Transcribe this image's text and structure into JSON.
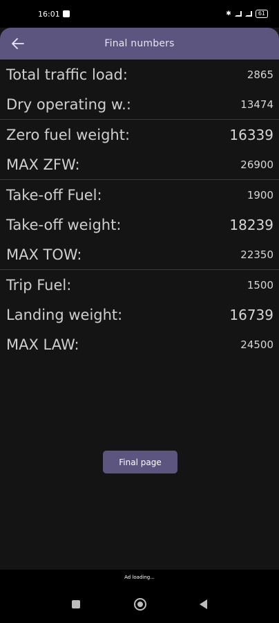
{
  "status": {
    "time": "16:01",
    "battery": "61"
  },
  "header": {
    "title": "Final numbers",
    "back_icon": "arrow-left-icon"
  },
  "groups": [
    {
      "rows": [
        {
          "label": "Total traffic load:",
          "value": "2865"
        },
        {
          "label": "Dry operating w.:",
          "value": "13474"
        }
      ]
    },
    {
      "rows": [
        {
          "label": "Zero fuel weight:",
          "value": "16339"
        },
        {
          "label": "MAX ZFW:",
          "value": "26900"
        }
      ]
    },
    {
      "rows": [
        {
          "label": "Take-off Fuel:",
          "value": "1900"
        },
        {
          "label": "Take-off weight:",
          "value": "18239"
        },
        {
          "label": "MAX TOW:",
          "value": "22350"
        }
      ]
    },
    {
      "rows": [
        {
          "label": "Trip Fuel:",
          "value": "1500"
        },
        {
          "label": "Landing weight:",
          "value": "16739"
        },
        {
          "label": "MAX LAW:",
          "value": "24500"
        }
      ]
    }
  ],
  "actions": {
    "final_page_label": "Final page"
  },
  "ad": {
    "text": "Ad loading..."
  },
  "colors": {
    "accent": "#5b5580",
    "background": "#141414"
  }
}
